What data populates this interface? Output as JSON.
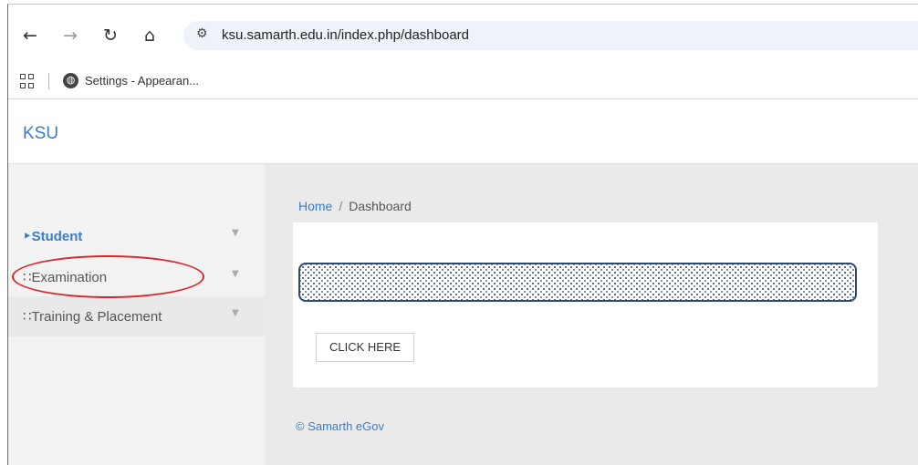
{
  "browser": {
    "url": "ksu.samarth.edu.in/index.php/dashboard",
    "bookmark_label": "Settings - Appearan..."
  },
  "app": {
    "brand": "KSU"
  },
  "sidebar": {
    "items": [
      {
        "label": "‣Student",
        "icon": "user-icon",
        "state": "active"
      },
      {
        "label": "∷Examination",
        "icon": "users-icon",
        "state": "normal"
      },
      {
        "label": "∷Training & Placement",
        "icon": "users-icon",
        "state": "hover"
      }
    ]
  },
  "breadcrumb": {
    "home": "Home",
    "separator": "/",
    "current": "Dashboard"
  },
  "main": {
    "button_label": "CLICK HERE"
  },
  "footer": {
    "text": "© Samarth eGov"
  },
  "colors": {
    "accent": "#3a7dc9",
    "annotation": "#d9252b",
    "sidebar_bg": "#f2f2f2",
    "main_bg": "#eaeaea"
  }
}
